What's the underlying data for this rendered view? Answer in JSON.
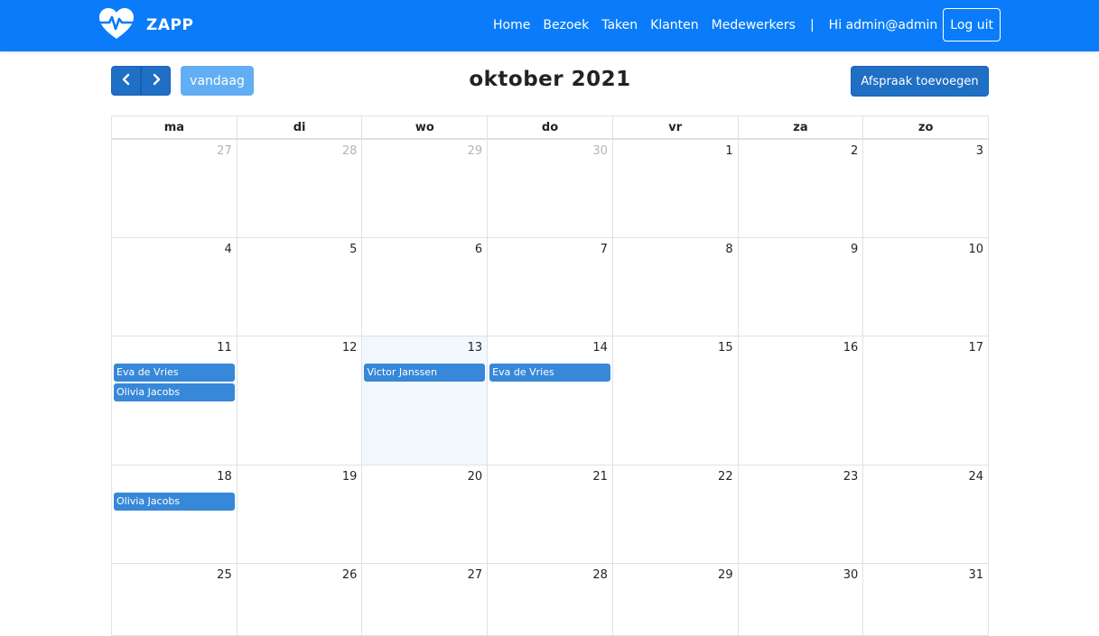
{
  "app": {
    "brand": "ZAPP",
    "logo_icon": "heart-pulse-icon"
  },
  "nav": {
    "items": [
      "Home",
      "Bezoek",
      "Taken",
      "Klanten",
      "Medewerkers"
    ],
    "separator": "|",
    "greeting": "Hi admin@admin",
    "logout": "Log uit"
  },
  "toolbar": {
    "prev_icon": "chevron-left-icon",
    "next_icon": "chevron-right-icon",
    "today": "vandaag",
    "title": "oktober 2021",
    "add": "Afspraak toevoegen"
  },
  "colors": {
    "navbar": "#0a7cf9",
    "primary": "#1f6fc5",
    "today_button": "#62aef4",
    "event": "#3788d8",
    "today_cell": "#f3f8fd"
  },
  "calendar": {
    "weekdays": [
      "ma",
      "di",
      "wo",
      "do",
      "vr",
      "za",
      "zo"
    ],
    "weeks": [
      [
        {
          "day": "27",
          "other": true,
          "events": []
        },
        {
          "day": "28",
          "other": true,
          "events": []
        },
        {
          "day": "29",
          "other": true,
          "events": []
        },
        {
          "day": "30",
          "other": true,
          "events": []
        },
        {
          "day": "1",
          "other": false,
          "events": []
        },
        {
          "day": "2",
          "other": false,
          "events": []
        },
        {
          "day": "3",
          "other": false,
          "events": []
        }
      ],
      [
        {
          "day": "4",
          "other": false,
          "events": []
        },
        {
          "day": "5",
          "other": false,
          "events": []
        },
        {
          "day": "6",
          "other": false,
          "events": []
        },
        {
          "day": "7",
          "other": false,
          "events": []
        },
        {
          "day": "8",
          "other": false,
          "events": []
        },
        {
          "day": "9",
          "other": false,
          "events": []
        },
        {
          "day": "10",
          "other": false,
          "events": []
        }
      ],
      [
        {
          "day": "11",
          "other": false,
          "events": [
            "Eva de Vries",
            "Olivia Jacobs"
          ]
        },
        {
          "day": "12",
          "other": false,
          "events": []
        },
        {
          "day": "13",
          "other": false,
          "today": true,
          "events": [
            "Victor Janssen"
          ]
        },
        {
          "day": "14",
          "other": false,
          "events": [
            "Eva de Vries"
          ]
        },
        {
          "day": "15",
          "other": false,
          "events": []
        },
        {
          "day": "16",
          "other": false,
          "events": []
        },
        {
          "day": "17",
          "other": false,
          "events": []
        }
      ],
      [
        {
          "day": "18",
          "other": false,
          "events": [
            "Olivia Jacobs"
          ]
        },
        {
          "day": "19",
          "other": false,
          "events": []
        },
        {
          "day": "20",
          "other": false,
          "events": []
        },
        {
          "day": "21",
          "other": false,
          "events": []
        },
        {
          "day": "22",
          "other": false,
          "events": []
        },
        {
          "day": "23",
          "other": false,
          "events": []
        },
        {
          "day": "24",
          "other": false,
          "events": []
        }
      ],
      [
        {
          "day": "25",
          "other": false,
          "events": []
        },
        {
          "day": "26",
          "other": false,
          "events": []
        },
        {
          "day": "27",
          "other": false,
          "events": []
        },
        {
          "day": "28",
          "other": false,
          "events": []
        },
        {
          "day": "29",
          "other": false,
          "events": []
        },
        {
          "day": "30",
          "other": false,
          "events": []
        },
        {
          "day": "31",
          "other": false,
          "events": []
        }
      ]
    ]
  }
}
